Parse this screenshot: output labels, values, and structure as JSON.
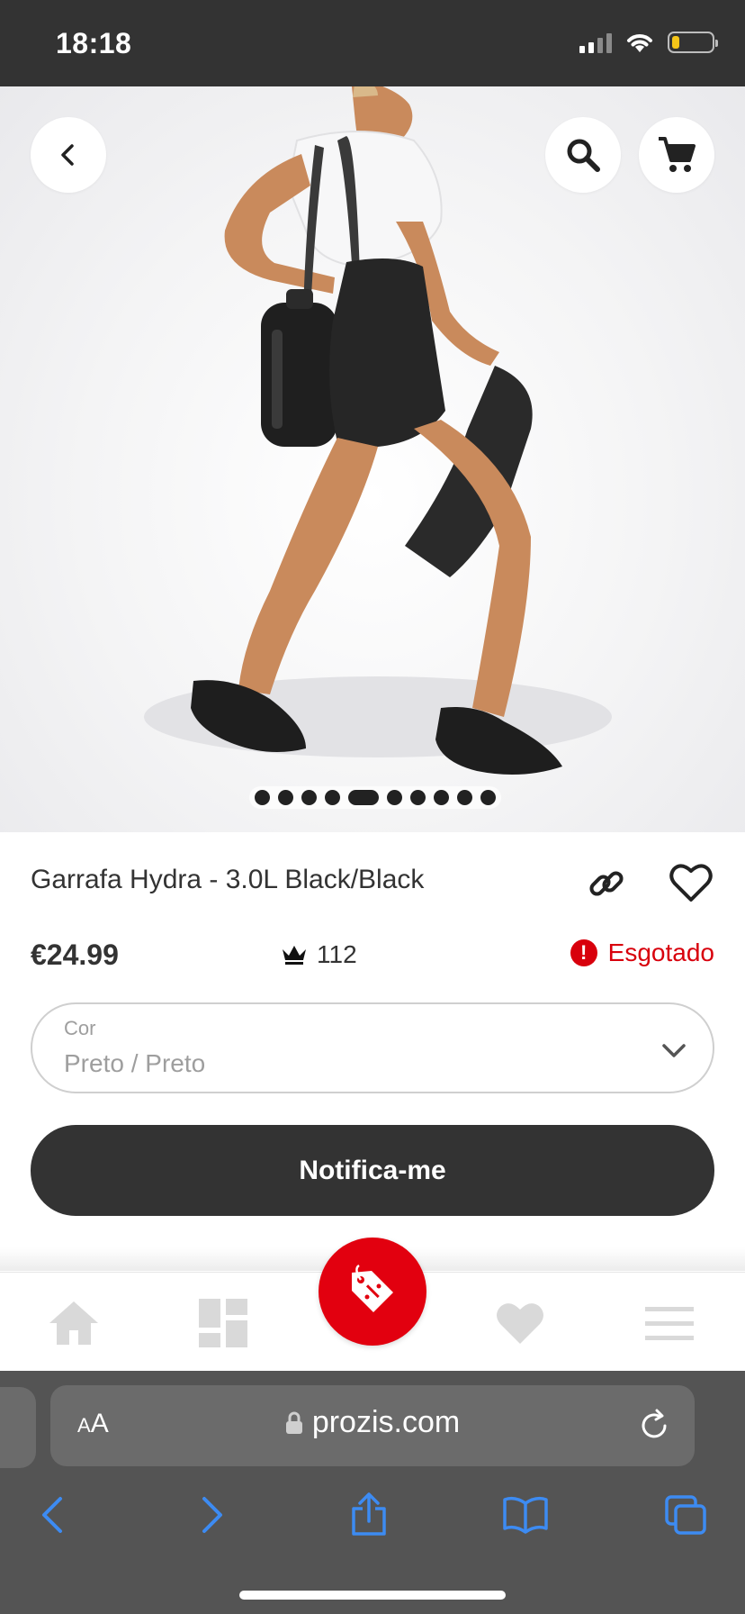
{
  "status_bar": {
    "time": "18:18",
    "battery_level": 0.2
  },
  "product": {
    "title": "Garrafa Hydra - 3.0L Black/Black",
    "price": "€24.99",
    "points": "112",
    "stock_status": "Esgotado",
    "image_count": 10,
    "active_image_index": 4
  },
  "color_select": {
    "label": "Cor",
    "value": "Preto / Preto"
  },
  "actions": {
    "notify_label": "Notifica-me"
  },
  "browser": {
    "aa_label_small": "A",
    "aa_label_large": "A",
    "url": "prozis.com"
  },
  "colors": {
    "accent_red": "#e2000f",
    "dark": "#333333",
    "safari_blue": "#3d8bf2"
  },
  "icons": {
    "top_left": "back-arrow-icon",
    "top_right": [
      "search-icon",
      "cart-icon"
    ],
    "bottom_nav": [
      "home-icon",
      "categories-icon",
      "promo-tag-icon",
      "heart-icon",
      "menu-icon"
    ],
    "safari_toolbar": [
      "back-icon",
      "forward-icon",
      "share-icon",
      "bookmarks-icon",
      "tabs-icon"
    ]
  }
}
